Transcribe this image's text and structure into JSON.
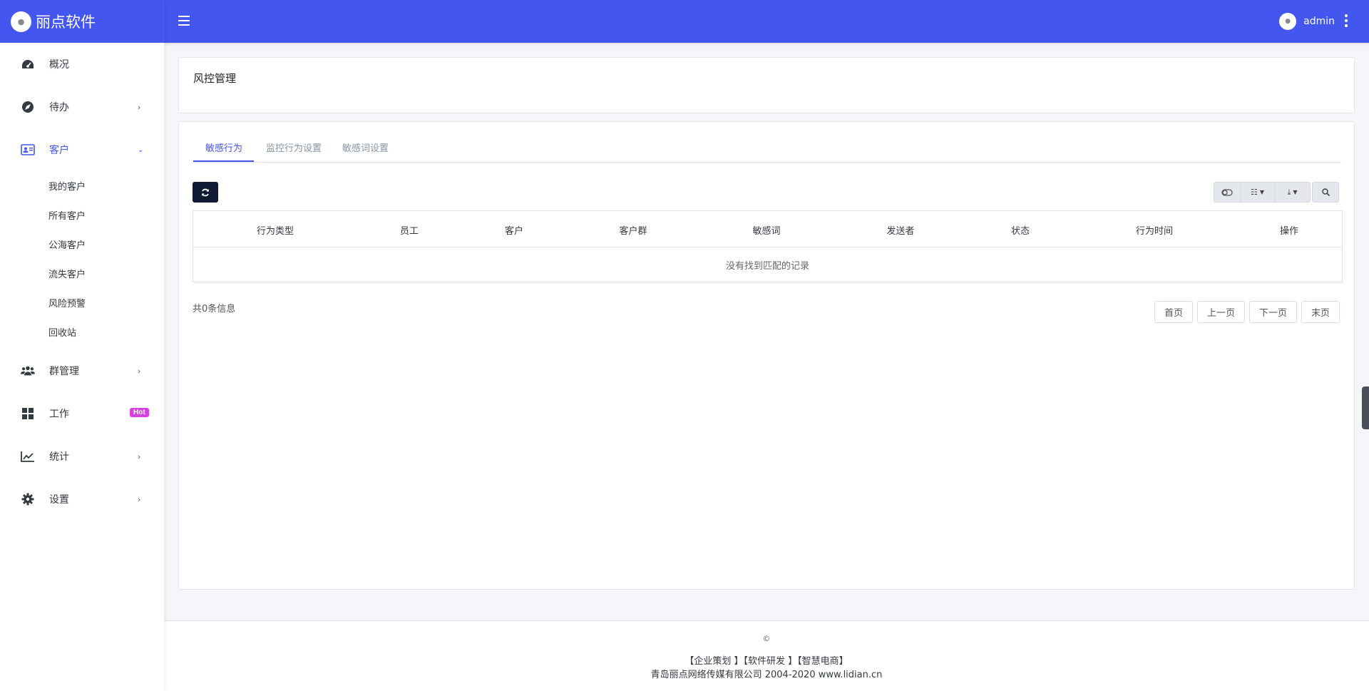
{
  "brand": {
    "name": "丽点软件",
    "logo_icon": "logo-icon"
  },
  "topbar": {
    "user_name": "admin"
  },
  "sidebar": {
    "items": [
      {
        "label": "概况",
        "icon": "dashboard-icon"
      },
      {
        "label": "待办",
        "icon": "compass-icon",
        "has_children": true
      },
      {
        "label": "客户",
        "icon": "contact-card-icon",
        "expanded": true,
        "children": [
          "我的客户",
          "所有客户",
          "公海客户",
          "流失客户",
          "风险预警",
          "回收站"
        ]
      },
      {
        "label": "群管理",
        "icon": "users-icon",
        "has_children": true
      },
      {
        "label": "工作",
        "icon": "grid-icon",
        "badge": "Hot"
      },
      {
        "label": "统计",
        "icon": "line-chart-icon",
        "has_children": true
      },
      {
        "label": "设置",
        "icon": "gear-icon",
        "has_children": true
      }
    ]
  },
  "page": {
    "title": "风控管理"
  },
  "tabs": [
    "敏感行为",
    "监控行为设置",
    "敏感词设置"
  ],
  "table": {
    "columns": [
      "行为类型",
      "员工",
      "客户",
      "客户群",
      "敏感词",
      "发送者",
      "状态",
      "行为时间",
      "操作"
    ],
    "empty_text": "没有找到匹配的记录"
  },
  "pagination": {
    "count_text": "共0条信息",
    "first": "首页",
    "prev": "上一页",
    "next": "下一页",
    "last": "末页"
  },
  "footer": {
    "copyright": "©",
    "links": "【企业策划 】【软件研发 】【智慧电商】",
    "company": "青岛丽点网络传媒有限公司 2004-2020 www.lidian.cn"
  },
  "colors": {
    "accent": "#4356f0",
    "dark_button": "#0e1a33",
    "hot_badge": "#d63fe0"
  }
}
